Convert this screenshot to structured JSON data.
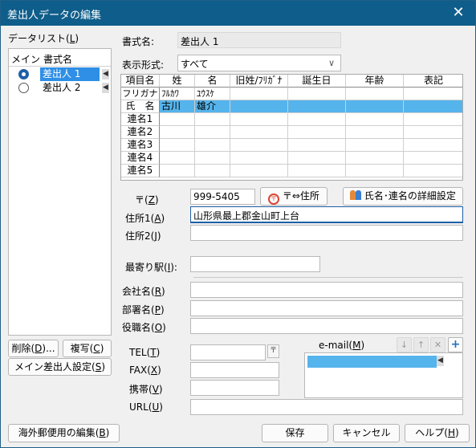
{
  "window": {
    "title": "差出人データの編集",
    "close_glyph": "✕"
  },
  "datalist": {
    "label_pre": "データリスト(",
    "label_key": "L",
    "label_post": ")",
    "col_main": "メイン",
    "col_format": "書式名",
    "items": [
      {
        "label": "差出人 1",
        "main": true,
        "selected": true
      },
      {
        "label": "差出人 2",
        "main": false,
        "selected": false
      }
    ]
  },
  "buttons": {
    "delete_pre": "削除(",
    "delete_key": "D",
    "delete_post": ")...",
    "copy_pre": "複写(",
    "copy_key": "C",
    "copy_post": ")",
    "set_main_pre": "メイン差出人設定(",
    "set_main_key": "S",
    "set_main_post": ")",
    "overseas_pre": "海外郵便用の編集(",
    "overseas_key": "B",
    "overseas_post": ")",
    "save": "保存",
    "cancel": "キャンセル",
    "help_pre": "ヘルプ(",
    "help_key": "H",
    "help_post": ")",
    "zip_address": "〒⇔住所",
    "detail": "氏名･連名の詳細設定"
  },
  "form": {
    "format_name_label": "書式名:",
    "format_name_value": "差出人 1",
    "display_format_label": "表示形式:",
    "display_format_value": "すべて",
    "zip_label_pre": "〒(",
    "zip_key": "Z",
    "zip_label_post": ")",
    "zip_value": "999-5405",
    "address1_label_pre": "住所1(",
    "address1_key": "A",
    "address1_label_post": ")",
    "address1_value": "山形県最上郡金山町上台",
    "address2_label_pre": "住所2(",
    "address2_key": "J",
    "address2_label_post": ")",
    "address2_value": "",
    "station_label_pre": "最寄り駅(",
    "station_key": "I",
    "station_label_post": "):",
    "station_value": "",
    "company_label_pre": "会社名(",
    "company_key": "R",
    "company_label_post": ")",
    "company_value": "",
    "dept_label_pre": "部署名(",
    "dept_key": "P",
    "dept_label_post": ")",
    "dept_value": "",
    "title_label_pre": "役職名(",
    "title_key": "O",
    "title_label_post": ")",
    "title_value": "",
    "tel_label_pre": "TEL(",
    "tel_key": "T",
    "tel_label_post": ")",
    "tel_value": "",
    "fax_label_pre": "FAX(",
    "fax_key": "X",
    "fax_label_post": ")",
    "fax_value": "",
    "mobile_label_pre": "携帯(",
    "mobile_key": "V",
    "mobile_label_post": ")",
    "mobile_value": "",
    "url_label_pre": "URL(",
    "url_key": "U",
    "url_label_post": ")",
    "url_value": "",
    "email_label_pre": "e-mail(",
    "email_key": "M",
    "email_label_post": ")"
  },
  "grid": {
    "headers": [
      "項目名",
      "姓",
      "名",
      "旧姓/ﾌﾘｶﾞﾅ",
      "誕生日",
      "年齢",
      "表記"
    ],
    "rows": [
      {
        "label": "フリガナ",
        "cells": [
          "ﾌﾙｶﾜ",
          "ﾕｳｽｹ",
          "",
          "",
          "",
          ""
        ]
      },
      {
        "label": "氏　名",
        "cells": [
          "古川",
          "雄介",
          "",
          "",
          "",
          ""
        ],
        "selected": true
      },
      {
        "label": "連名1",
        "cells": [
          "",
          "",
          "",
          "",
          "",
          ""
        ]
      },
      {
        "label": "連名2",
        "cells": [
          "",
          "",
          "",
          "",
          "",
          ""
        ]
      },
      {
        "label": "連名3",
        "cells": [
          "",
          "",
          "",
          "",
          "",
          ""
        ]
      },
      {
        "label": "連名4",
        "cells": [
          "",
          "",
          "",
          "",
          "",
          ""
        ]
      },
      {
        "label": "連名5",
        "cells": [
          "",
          "",
          "",
          "",
          "",
          ""
        ]
      }
    ]
  },
  "email_tools": {
    "down": "↓",
    "up": "↑",
    "remove": "✕",
    "add": "+"
  },
  "colors": {
    "titlebar": "#0f5d8a",
    "selection": "#56b4ec",
    "list_selection": "#2f8fe6"
  }
}
